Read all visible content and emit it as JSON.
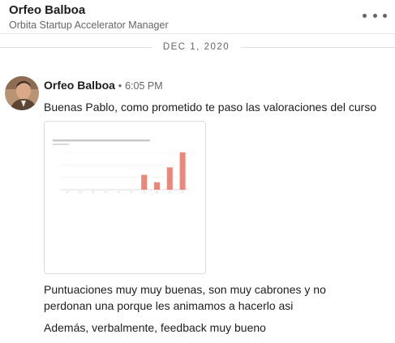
{
  "header": {
    "name": "Orfeo Balboa",
    "subtitle": "Orbita Startup Accelerator Manager",
    "more_icon": "more-horizontal-icon"
  },
  "date_divider": "DEC 1, 2020",
  "message": {
    "sender": "Orfeo Balboa",
    "separator": "•",
    "time": "6:05 PM",
    "avatar_icon": "avatar-photo",
    "lines": [
      "Buenas Pablo, como prometido te paso las valoraciones del curso",
      "Puntuaciones muy muy buenas, son muy cabrones y no perdonan una porque les animamos a hacerlo asi",
      "Además, verbalmente, feedback muy bueno"
    ]
  },
  "attachment": {
    "type": "image",
    "chart_data": {
      "type": "bar",
      "categories": [
        "1",
        "2",
        "3",
        "4",
        "5",
        "6",
        "7",
        "8",
        "9",
        "10"
      ],
      "values": [
        0,
        0,
        0,
        0,
        0,
        0,
        2,
        1,
        3,
        5
      ],
      "bar_color": "#e8877a"
    }
  },
  "colors": {
    "text": "#1d1d1d",
    "muted": "#666666",
    "divider": "#e0e0e0",
    "bar": "#e8877a"
  }
}
